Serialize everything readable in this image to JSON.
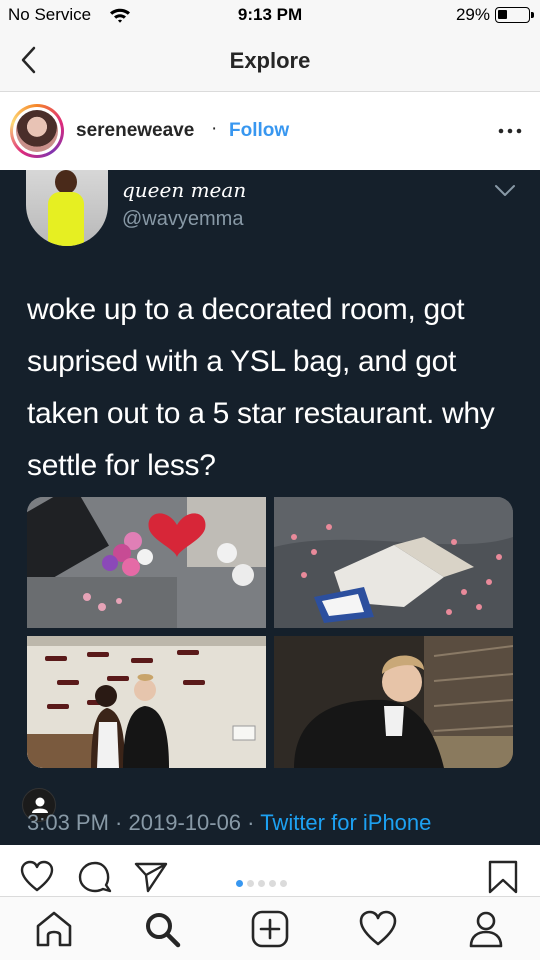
{
  "status_bar": {
    "carrier": "No Service",
    "time": "9:13 PM",
    "battery_percent": "29%",
    "battery_level": 0.29,
    "icons": [
      "wifi-icon",
      "battery-icon"
    ]
  },
  "nav": {
    "title": "Explore",
    "back_icon": "chevron-left-icon"
  },
  "post": {
    "username": "sereneweave",
    "separator": "·",
    "follow_label": "Follow",
    "more_icon": "more-horizontal-icon"
  },
  "tweet": {
    "display_name": "queen mean",
    "handle": "@wavyemma",
    "text": "woke up to a decorated room, got suprised with a YSL bag, and got taken out to a 5 star restaurant. why settle for less?",
    "time": "3:03 PM",
    "date": "2019-10-06",
    "meta_sep": " · ",
    "source": "Twitter for iPhone",
    "colors": {
      "background": "#15202b",
      "text": "#ffffff",
      "muted": "#8899a6",
      "link": "#1da1f2"
    }
  },
  "action_bar": {
    "icons": [
      "heart-icon",
      "comment-icon",
      "share-icon",
      "bookmark-icon"
    ],
    "carousel_count": 5,
    "carousel_active": 0
  },
  "tab_bar": {
    "icons": [
      "home-icon",
      "search-icon",
      "new-post-icon",
      "activity-heart-icon",
      "profile-icon"
    ],
    "active": "search-icon"
  },
  "colors": {
    "accent": "#3897f0"
  }
}
